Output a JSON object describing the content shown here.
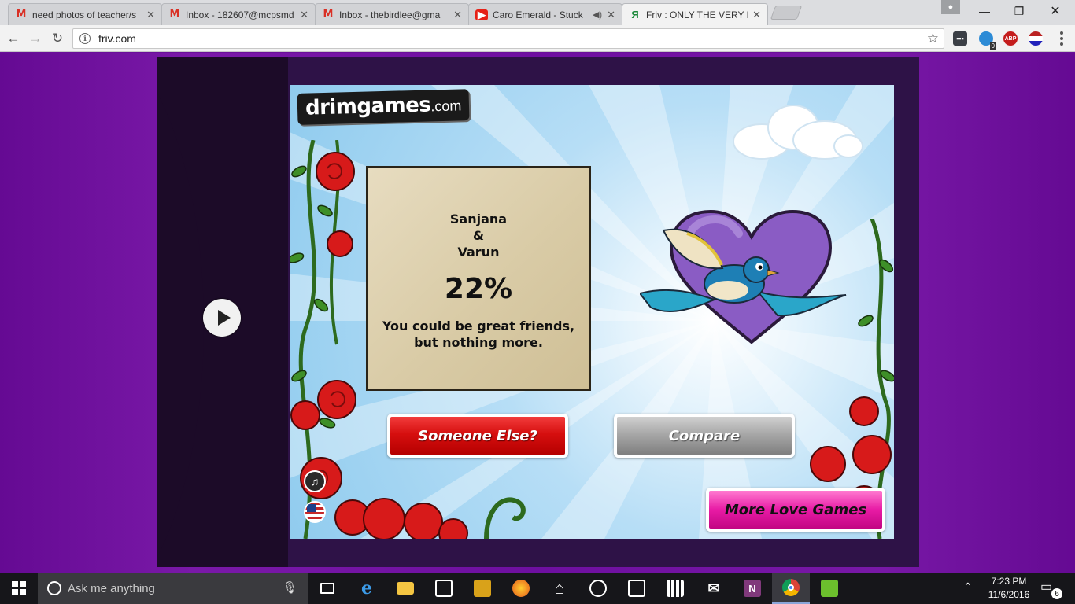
{
  "browser": {
    "tabs": [
      {
        "title": "need photos of teacher/s",
        "favicon": "gmail-icon",
        "active": false
      },
      {
        "title": "Inbox - 182607@mcpsmd",
        "favicon": "gmail-icon",
        "active": false
      },
      {
        "title": "Inbox - thebirdlee@gma",
        "favicon": "gmail-icon",
        "active": false
      },
      {
        "title": "Caro Emerald - Stuck",
        "favicon": "youtube-icon",
        "active": false
      },
      {
        "title": "Friv : ONLY THE VERY BES",
        "favicon": "friv-icon",
        "active": true
      }
    ],
    "url": "friv.com",
    "extension_badges": {
      "ghostery": "0",
      "adblock": "ABP"
    }
  },
  "game": {
    "logo": {
      "brand": "drimgames",
      "tld": ".com"
    },
    "result": {
      "name1": "Sanjana",
      "ampersand": "&",
      "name2": "Varun",
      "percent": "22%",
      "message": "You could be great friends, but nothing more."
    },
    "buttons": {
      "someone_else": "Someone Else?",
      "compare": "Compare",
      "more_games": "More Love Games"
    },
    "colors": {
      "red": "#d60f0f",
      "gray": "#a8a8a8",
      "pink": "#e81ba5",
      "heart": "#8a5cc4",
      "bird": "#1e7fb5"
    }
  },
  "taskbar": {
    "search_placeholder": "Ask me anything",
    "time": "7:23 PM",
    "date": "11/6/2016",
    "notifications": "6"
  }
}
